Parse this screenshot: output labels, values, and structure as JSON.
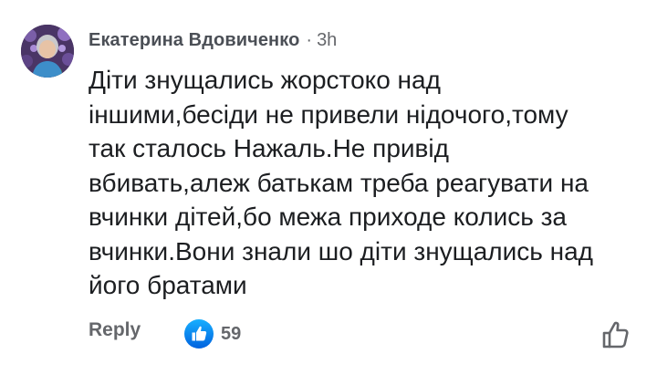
{
  "comment": {
    "author": "Екатерина Вдовиченко",
    "separator": "·",
    "timestamp": "3h",
    "text": "Діти знущались жорстоко над\nіншими,бесіди не привели нідочого,тому\nтак сталось Нажаль.Не привід\nвбивать,алеж батькам треба реагувати на\nвчинки дітей,бо межа приходе колись за\nвчинки.Вони знали шо діти знущались над\nйого братами"
  },
  "actions": {
    "reply_label": "Reply",
    "reaction_icon": "like-reaction-icon",
    "reaction_count": "59",
    "like_icon": "thumbs-up-outline-icon"
  },
  "colors": {
    "like_blue": "#1877f2",
    "secondary_text": "#65676b"
  }
}
